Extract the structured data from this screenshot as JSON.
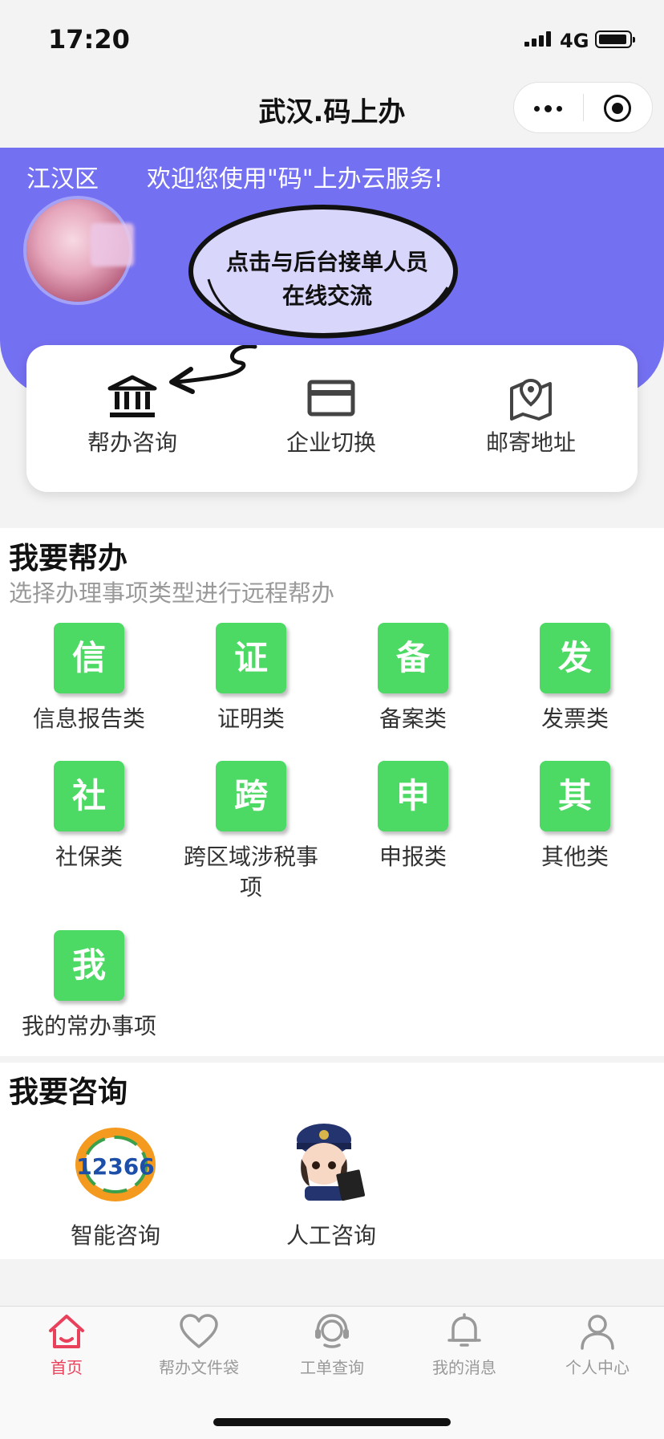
{
  "status_bar": {
    "time": "17:20",
    "network": "4G"
  },
  "nav": {
    "title": "武汉.码上办"
  },
  "banner": {
    "district": "江汉区",
    "welcome": "欢迎您使用\"码\"上办云服务!",
    "bubble_line1": "点击与后台接单人员",
    "bubble_line2": "在线交流"
  },
  "quick_actions": [
    {
      "label": "帮办咨询",
      "icon": "bank-icon"
    },
    {
      "label": "企业切换",
      "icon": "card-icon"
    },
    {
      "label": "邮寄地址",
      "icon": "map-pin-icon"
    }
  ],
  "help": {
    "title": "我要帮办",
    "subtitle": "选择办理事项类型进行远程帮办",
    "items": [
      {
        "char": "信",
        "label": "信息报告类"
      },
      {
        "char": "证",
        "label": "证明类"
      },
      {
        "char": "备",
        "label": "备案类"
      },
      {
        "char": "发",
        "label": "发票类"
      },
      {
        "char": "社",
        "label": "社保类"
      },
      {
        "char": "跨",
        "label": "跨区域涉税事项"
      },
      {
        "char": "申",
        "label": "申报类"
      },
      {
        "char": "其",
        "label": "其他类"
      },
      {
        "char": "我",
        "label": "我的常办事项"
      }
    ]
  },
  "consult": {
    "title": "我要咨询",
    "items": [
      {
        "label": "智能咨询",
        "icon": "12366-hotline-logo",
        "logo_text": "12366"
      },
      {
        "label": "人工咨询",
        "icon": "customer-service-agent-icon"
      }
    ]
  },
  "tabs": [
    {
      "label": "首页",
      "icon": "home-icon",
      "active": true
    },
    {
      "label": "帮办文件袋",
      "icon": "heart-icon",
      "active": false
    },
    {
      "label": "工单查询",
      "icon": "headset-icon",
      "active": false
    },
    {
      "label": "我的消息",
      "icon": "bell-icon",
      "active": false
    },
    {
      "label": "个人中心",
      "icon": "user-icon",
      "active": false
    }
  ],
  "colors": {
    "banner": "#7470f2",
    "tile": "#4cd964",
    "active_tab": "#e9415b"
  }
}
